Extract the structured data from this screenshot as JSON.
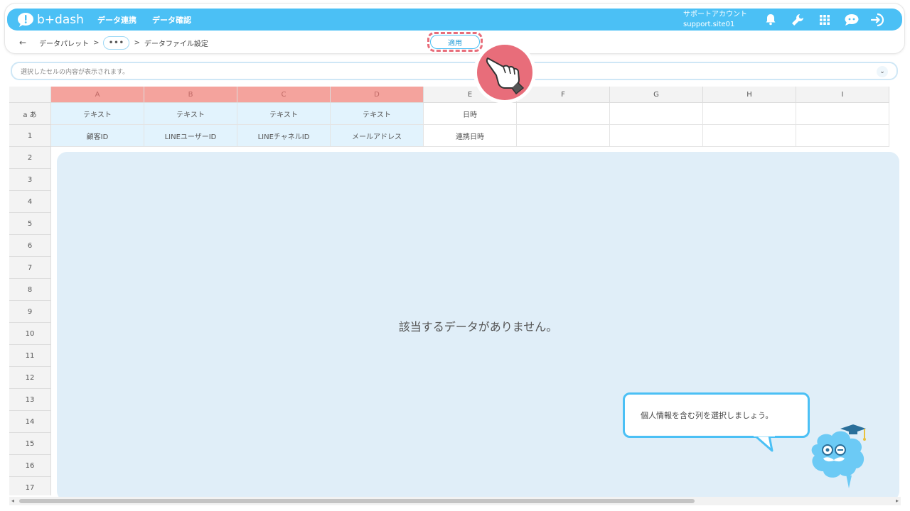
{
  "header": {
    "logo_text": "b+dash",
    "nav": [
      "データ連携",
      "データ確認"
    ],
    "account_line1": "サポートアカウント",
    "account_line2": "support.site01",
    "icons": [
      "bell-icon",
      "wrench-icon",
      "grid-icon",
      "chat-icon",
      "logout-icon"
    ]
  },
  "breadcrumb": {
    "back_label": "←",
    "items": [
      "データパレット",
      "データファイル設定"
    ],
    "separator": ">",
    "more_label": "•••"
  },
  "apply_button": {
    "label": "適用"
  },
  "cell_content": {
    "placeholder": "選択したセルの内容が表示されます。"
  },
  "grid": {
    "columns": [
      "A",
      "B",
      "C",
      "D",
      "E",
      "F",
      "G",
      "H",
      "I"
    ],
    "selected_columns": [
      "A",
      "B",
      "C",
      "D"
    ],
    "type_row_label": "a あ",
    "type_row": [
      "テキスト",
      "テキスト",
      "テキスト",
      "テキスト",
      "日時",
      "",
      "",
      "",
      ""
    ],
    "header_row": [
      "顧客ID",
      "LINEユーザーID",
      "LINEチャネルID",
      "メールアドレス",
      "連携日時",
      "",
      "",
      "",
      ""
    ],
    "row_numbers": [
      "1",
      "2",
      "3",
      "4",
      "5",
      "6",
      "7",
      "8",
      "9",
      "10",
      "11",
      "12",
      "13",
      "14",
      "15",
      "16",
      "17"
    ],
    "empty_message": "該当するデータがありません。"
  },
  "tooltip": {
    "text": "個人情報を含む列を選択しましょう。"
  },
  "colors": {
    "brand": "#4bc0f5",
    "selected_header": "#f4a39d",
    "selected_cell": "#e2f3fd",
    "highlight": "#e86d7a"
  }
}
